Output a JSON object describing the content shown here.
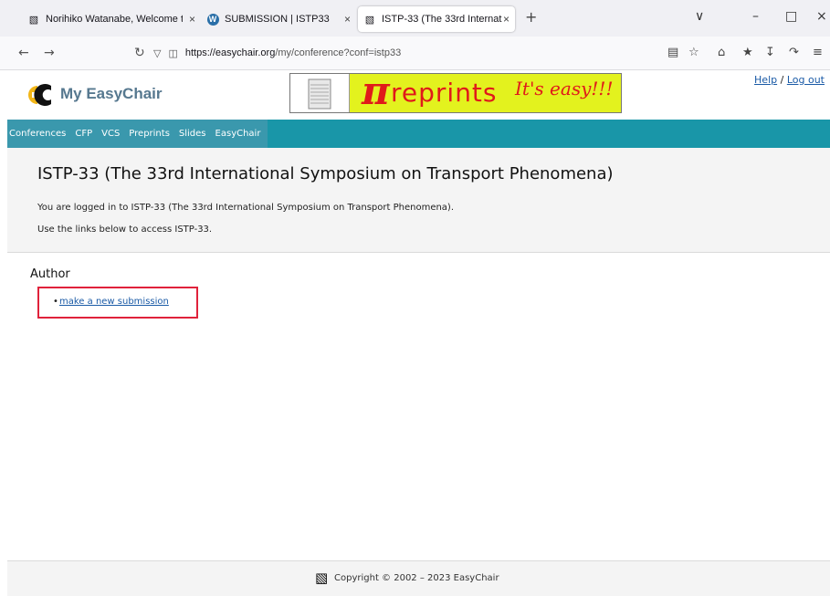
{
  "browser": {
    "tabs": [
      {
        "label": "Norihiko Watanabe, Welcome t",
        "close": "×"
      },
      {
        "label": "SUBMISSION | ISTP33",
        "close": "×"
      },
      {
        "label": "ISTP-33 (The 33rd International",
        "close": "×"
      }
    ],
    "new_tab": "+",
    "url_host": "https://easychair.org",
    "url_path": "/my/conference?conf=istp33",
    "window_controls": [
      "∨",
      "–",
      "□",
      "×"
    ]
  },
  "header": {
    "logo_text": "My EasyChair",
    "banner_pi": "π",
    "banner_text": "reprints",
    "banner_slogan": "It's easy!!!",
    "help": "Help",
    "sep": "/",
    "logout": "Log out"
  },
  "menu": [
    "Conferences",
    "CFP",
    "VCS",
    "Preprints",
    "Slides",
    "EasyChair"
  ],
  "info": {
    "title": "ISTP-33 (The 33rd International Symposium on Transport Phenomena)",
    "line1": "You are logged in to ISTP-33 (The 33rd International Symposium on Transport Phenomena).",
    "line2": "Use the links below to access ISTP-33."
  },
  "author": {
    "heading": "Author",
    "bullet": "•",
    "link": "make a new submission"
  },
  "footer": {
    "copyright": "Copyright © 2002 – 2023 EasyChair"
  },
  "colors": {
    "menubar": "#1996a8",
    "highlight_box": "#e0223b",
    "banner_bg": "#e3f21e",
    "banner_text": "#e01a1a"
  }
}
